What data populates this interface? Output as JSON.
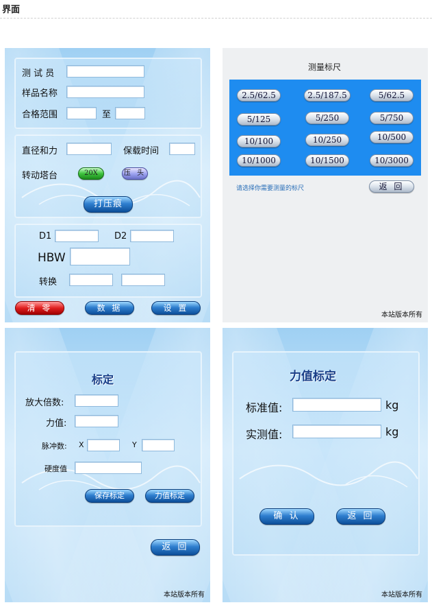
{
  "page_title": "界面",
  "main_panel": {
    "tester_label": "测 试 员",
    "sample_label": "样品名称",
    "range_label": "合格范围",
    "range_to": "至",
    "force_label": "直径和力",
    "hold_time_label": "保载时间",
    "turret_label": "转动塔台",
    "btn_20x": "20X",
    "btn_indenter": "压 头",
    "btn_indent": "打压痕",
    "d1_label": "D1",
    "d2_label": "D2",
    "hbw_label": "HBW",
    "convert_label": "转换",
    "btn_clear": "清 零",
    "btn_data": "数 据",
    "btn_settings": "设 置"
  },
  "scale_panel": {
    "title": "测量标尺",
    "scales": [
      "2.5/62.5",
      "2.5/187.5",
      "5/62.5",
      "5/125",
      "5/250",
      "5/750",
      "10/100",
      "10/250",
      "10/500",
      "10/1000",
      "10/1500",
      "10/3000"
    ],
    "hint": "请选择你需要测量的标尺",
    "btn_back": "返 回",
    "copyright": "本站版本所有"
  },
  "calib_panel": {
    "title": "标定",
    "magnification_label": "放大倍数:",
    "force_label": "力值:",
    "pulse_label": "脉冲数:",
    "x_label": "X",
    "y_label": "Y",
    "hardness_label": "硬度值",
    "btn_save": "保存标定",
    "btn_force_calib": "力值标定",
    "btn_back": "返 回",
    "copyright": "本站版本所有"
  },
  "force_panel": {
    "title": "力值标定",
    "standard_label": "标准值:",
    "measured_label": "实测值:",
    "unit": "kg",
    "btn_confirm": "确 认",
    "btn_back": "返 回",
    "copyright": "本站版本所有"
  }
}
